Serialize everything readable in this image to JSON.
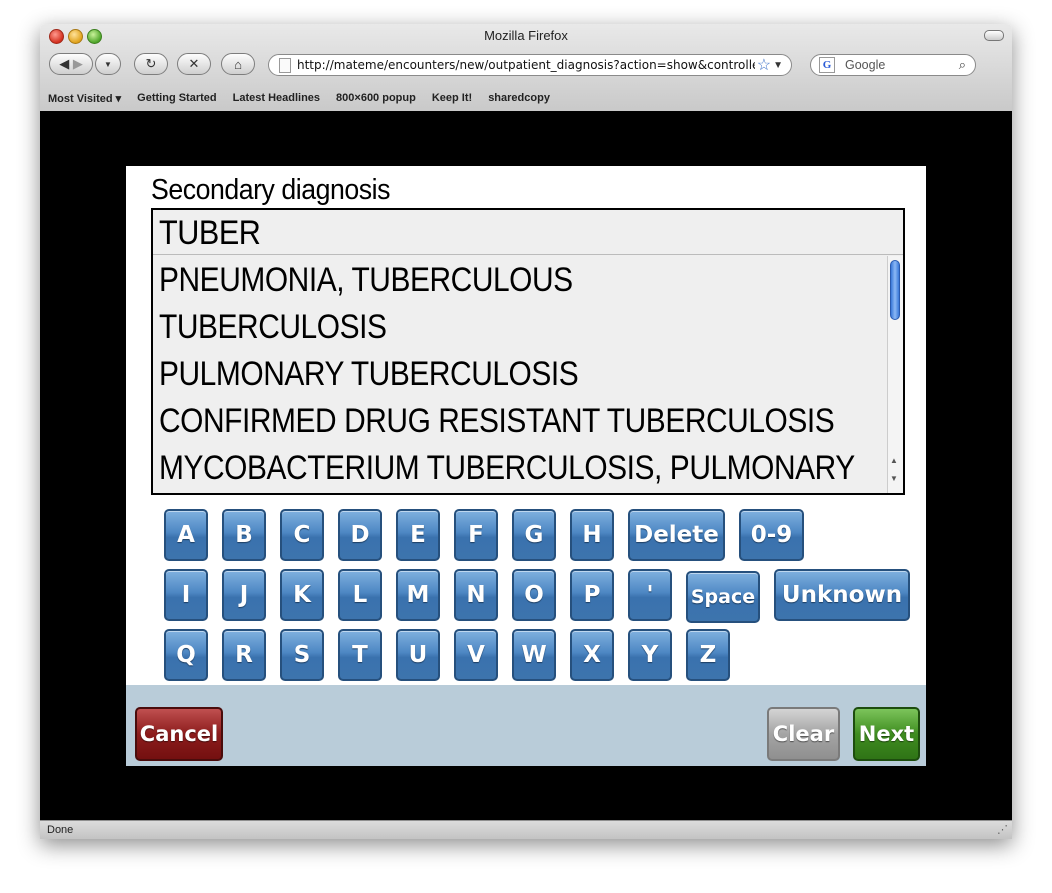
{
  "browser": {
    "window_title": "Mozilla Firefox",
    "url": "http://mateme/encounters/new/outpatient_diagnosis?action=show&controller=encounters",
    "search_placeholder": "Google",
    "bookmarks": [
      "Most Visited ▾",
      "Getting Started",
      "Latest Headlines",
      "800×600 popup",
      "Keep It!",
      "sharedcopy"
    ],
    "status": "Done"
  },
  "form": {
    "question": "Secondary diagnosis",
    "typed_value": "TUBER",
    "options": [
      "PNEUMONIA, TUBERCULOUS",
      "TUBERCULOSIS",
      "PULMONARY TUBERCULOSIS",
      "CONFIRMED DRUG RESISTANT TUBERCULOSIS",
      "MYCOBACTERIUM TUBERCULOSIS, PULMONARY"
    ]
  },
  "keyboard": {
    "row1": [
      "A",
      "B",
      "C",
      "D",
      "E",
      "F",
      "G",
      "H",
      "Delete",
      "0-9"
    ],
    "row2": [
      "I",
      "J",
      "K",
      "L",
      "M",
      "N",
      "O",
      "P",
      "'",
      "Space",
      "Unknown"
    ],
    "row3": [
      "Q",
      "R",
      "S",
      "T",
      "U",
      "V",
      "W",
      "X",
      "Y",
      "Z"
    ]
  },
  "footer": {
    "cancel": "Cancel",
    "clear": "Clear",
    "next": "Next"
  }
}
